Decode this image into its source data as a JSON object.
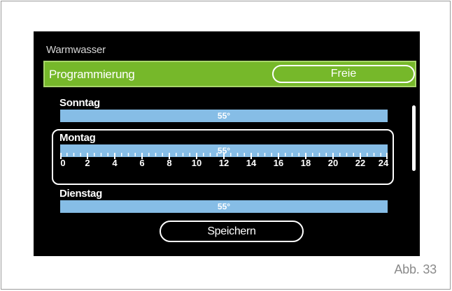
{
  "screen": {
    "title": "Warmwasser",
    "programming": {
      "label": "Programmierung",
      "value": "Freie"
    },
    "days": [
      {
        "name": "Sonntag",
        "temp": "55°"
      },
      {
        "name": "Montag",
        "temp": "55°"
      },
      {
        "name": "Dienstag",
        "temp": "55°"
      }
    ],
    "hours": [
      "0",
      "2",
      "4",
      "6",
      "8",
      "10",
      "12",
      "14",
      "16",
      "18",
      "20",
      "22",
      "24"
    ],
    "save_label": "Speichern"
  },
  "caption": "Abb. 33",
  "colors": {
    "accent_green": "#76b82a",
    "bar_blue": "#86bde6",
    "screen_bg": "#000000"
  }
}
